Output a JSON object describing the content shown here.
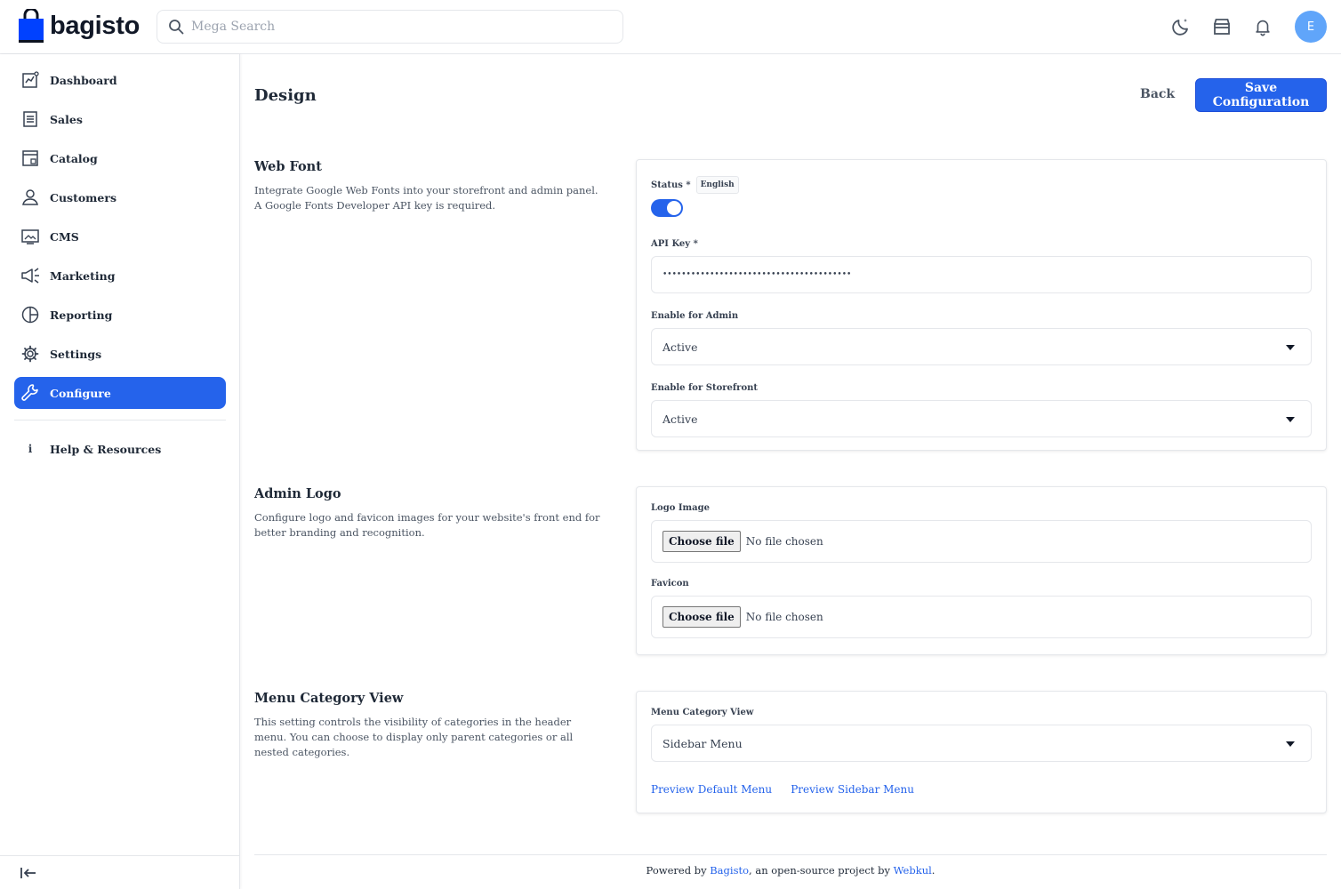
{
  "brand": {
    "name": "bagisto",
    "color": "#0041ff"
  },
  "search": {
    "placeholder": "Mega Search"
  },
  "header": {
    "avatar_letter": "E",
    "icons": [
      "dark-mode-icon",
      "storefront-icon",
      "bell-icon"
    ]
  },
  "sidebar": {
    "items": [
      {
        "label": "Dashboard",
        "icon": "dashboard-icon"
      },
      {
        "label": "Sales",
        "icon": "sales-icon"
      },
      {
        "label": "Catalog",
        "icon": "catalog-icon"
      },
      {
        "label": "Customers",
        "icon": "customers-icon"
      },
      {
        "label": "CMS",
        "icon": "cms-icon"
      },
      {
        "label": "Marketing",
        "icon": "marketing-icon"
      },
      {
        "label": "Reporting",
        "icon": "reporting-icon"
      },
      {
        "label": "Settings",
        "icon": "settings-icon"
      },
      {
        "label": "Configure",
        "icon": "configure-icon",
        "active": true
      }
    ],
    "help_label": "Help & Resources"
  },
  "page": {
    "title": "Design",
    "back_label": "Back",
    "save_label": "Save Configuration"
  },
  "sections": {
    "web_font": {
      "title": "Web Font",
      "description": "Integrate Google Web Fonts into your storefront and admin panel. A Google Fonts Developer API key is required.",
      "status_label": "Status *",
      "locale_badge": "English",
      "status_on": true,
      "api_key_label": "API Key *",
      "api_key_value": "••••••••••••••••••••••••••••••••••••••••",
      "enable_admin_label": "Enable for Admin",
      "enable_admin_value": "Active",
      "enable_storefront_label": "Enable for Storefront",
      "enable_storefront_value": "Active"
    },
    "admin_logo": {
      "title": "Admin Logo",
      "description": "Configure logo and favicon images for your website's front end for better branding and recognition.",
      "logo_label": "Logo Image",
      "favicon_label": "Favicon",
      "choose_file": "Choose file",
      "no_file": "No file chosen"
    },
    "menu_category": {
      "title": "Menu Category View",
      "description": "This setting controls the visibility of categories in the header menu. You can choose to display only parent categories or all nested categories.",
      "field_label": "Menu Category View",
      "field_value": "Sidebar Menu",
      "preview_default": "Preview Default Menu",
      "preview_sidebar": "Preview Sidebar Menu"
    }
  },
  "footer": {
    "prefix": "Powered by ",
    "brand": "Bagisto",
    "middle": ", an open-source project by ",
    "company": "Webkul",
    "suffix": "."
  }
}
